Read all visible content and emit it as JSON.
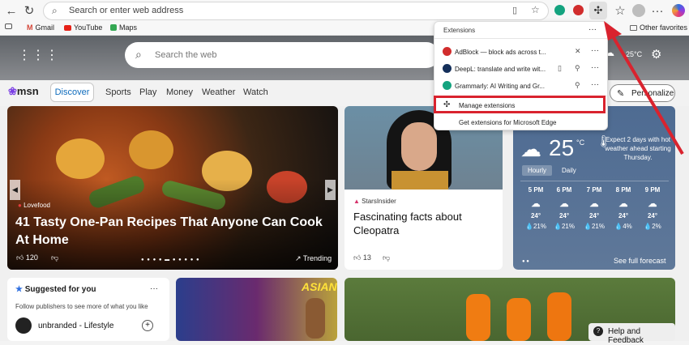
{
  "browser": {
    "address_placeholder": "Search or enter web address",
    "bookmarks": [
      "Gmail",
      "YouTube",
      "Maps"
    ],
    "other_favorites": "Other favorites"
  },
  "extensions_menu": {
    "title": "Extensions",
    "more": "···",
    "items": [
      {
        "label": "AdBlock — block ads across t...",
        "color": "#d12d2d"
      },
      {
        "label": "DeepL: translate and write wit...",
        "color": "#142f5a"
      },
      {
        "label": "Grammarly: AI Writing and Gr...",
        "color": "#14a37f"
      }
    ],
    "manage": "Manage extensions",
    "get": "Get extensions for Microsoft Edge"
  },
  "msn": {
    "search_placeholder": "Search the web",
    "logo": "msn",
    "tabs": [
      "Discover",
      "Sports",
      "Play",
      "Money",
      "Weather",
      "Watch"
    ],
    "personalize": "Personalize"
  },
  "hero": {
    "source": "Lovefood",
    "title": "41 Tasty One-Pan Recipes That Anyone Can Cook At Home",
    "likes": "120",
    "trending": "Trending"
  },
  "card2": {
    "source": "StarsInsider",
    "title": "Fascinating facts about Cleopatra",
    "likes": "13"
  },
  "weather": {
    "temp": "25",
    "unit": "°C",
    "note": "Expect 2 days with hot weather ahead starting Thursday.",
    "tabs": [
      "Hourly",
      "Daily"
    ],
    "hours": [
      {
        "time": "5 PM",
        "temp": "24°",
        "precip": "21%"
      },
      {
        "time": "6 PM",
        "temp": "24°",
        "precip": "21%"
      },
      {
        "time": "7 PM",
        "temp": "24°",
        "precip": "21%"
      },
      {
        "time": "8 PM",
        "temp": "24°",
        "precip": "4%"
      },
      {
        "time": "9 PM",
        "temp": "24°",
        "precip": "2%"
      }
    ],
    "forecast_link": "See full forecast",
    "top_temp": "25",
    "top_unit": "°C"
  },
  "suggested": {
    "title": "Suggested for you",
    "subtitle": "Follow publishers to see more of what you like",
    "publisher": "unbranded - Lifestyle"
  },
  "help": "Help and Feedback",
  "colors": {
    "accent": "#0f6cbd",
    "highlight": "#d9232e"
  }
}
